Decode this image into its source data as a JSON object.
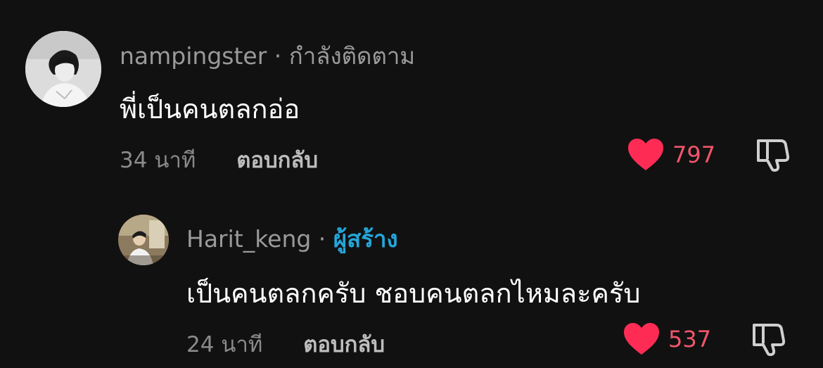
{
  "comments": [
    {
      "username": "nampingster",
      "separator": " · ",
      "tag": "กำลังติดตาม",
      "text": "พี่เป็นคนตลกอ่อ",
      "time": "34 นาที",
      "reply_label": "ตอบกลับ",
      "likes": "797"
    },
    {
      "username": "Harit_keng",
      "separator": " · ",
      "tag": "ผู้สร้าง",
      "text": "เป็นคนตลกครับ ชอบคนตลกไหมละครับ",
      "time": "24 นาที",
      "reply_label": "ตอบกลับ",
      "likes": "537"
    }
  ],
  "colors": {
    "background": "#111111",
    "heart": "#fe2c55",
    "like_count": "#f0566c",
    "creator_tag": "#25a6d9"
  },
  "icons": {
    "like": "heart-icon",
    "dislike": "thumbs-down-icon"
  }
}
